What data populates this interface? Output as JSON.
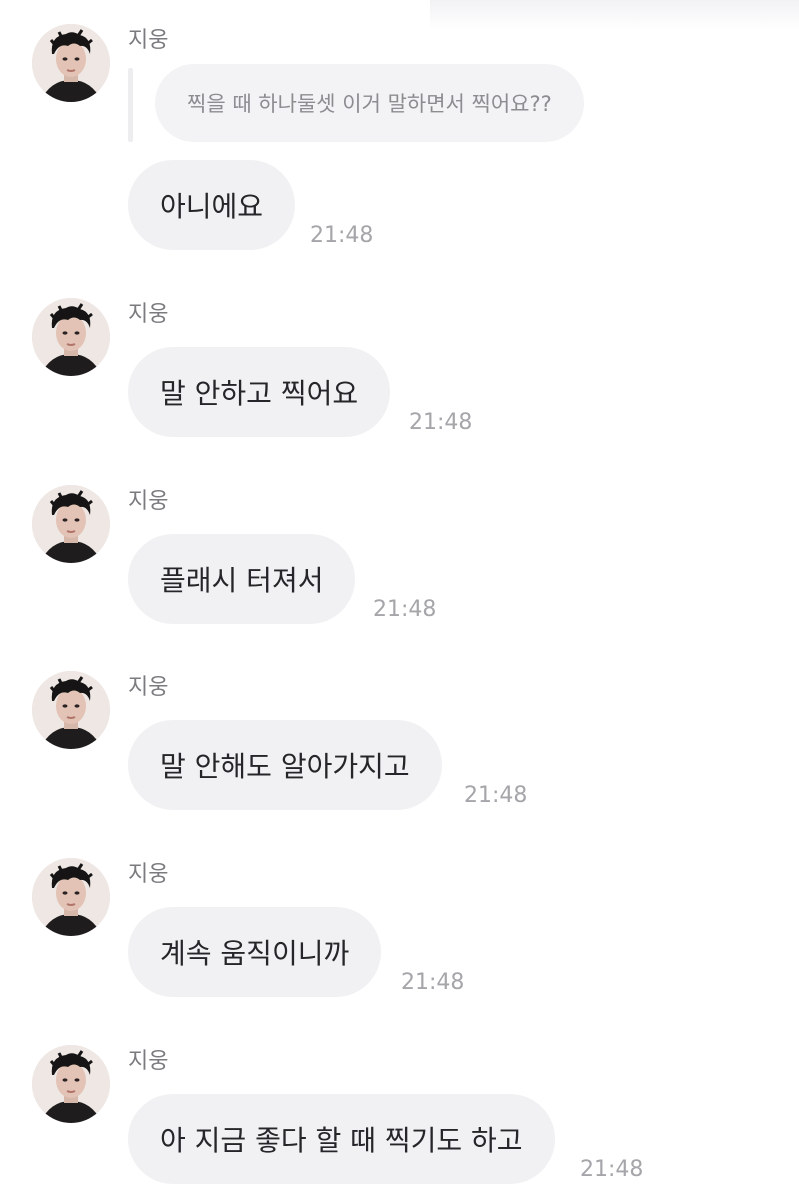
{
  "chat": {
    "quote": "찍을 때 하나둘셋 이거 말하면서 찍어요??",
    "messages": [
      {
        "sender": "지웅",
        "text": "아니에요",
        "time": "21:48"
      },
      {
        "sender": "지웅",
        "text": "말 안하고 찍어요",
        "time": "21:48"
      },
      {
        "sender": "지웅",
        "text": "플래시 터져서",
        "time": "21:48"
      },
      {
        "sender": "지웅",
        "text": "말 안해도 알아가지고",
        "time": "21:48"
      },
      {
        "sender": "지웅",
        "text": "계속 움직이니까",
        "time": "21:48"
      },
      {
        "sender": "지웅",
        "text": "아 지금 좋다 할 때 찍기도 하고",
        "time": "21:48"
      }
    ]
  },
  "colors": {
    "bubble_bg": "#f1f1f3",
    "quote_bg": "#f3f3f5",
    "text": "#26262a",
    "sender": "#7a7a7f",
    "time": "#a5a5aa"
  },
  "icons": {
    "avatar": "profile-photo"
  }
}
